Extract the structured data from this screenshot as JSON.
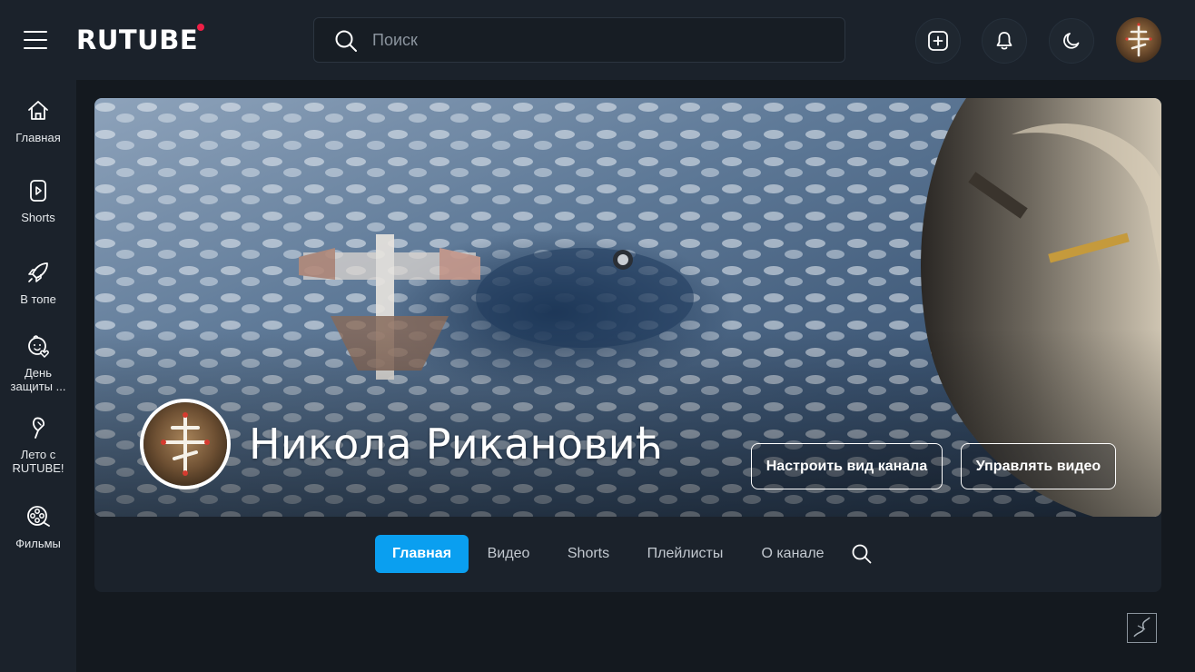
{
  "header": {
    "logo_text": "RUTUBE",
    "search_placeholder": "Поиск",
    "accent_dot_color": "#ee1f46"
  },
  "sidebar": {
    "items": [
      {
        "label": "Главная",
        "icon": "home-icon"
      },
      {
        "label": "Shorts",
        "icon": "shorts-icon"
      },
      {
        "label": "В топе",
        "icon": "rocket-icon"
      },
      {
        "label": "День\nзащиты ...",
        "icon": "child-heart-icon"
      },
      {
        "label": "Лето с\nRUTUBE!",
        "icon": "ice-cream-icon"
      },
      {
        "label": "Фильмы",
        "icon": "film-reel-icon"
      }
    ]
  },
  "channel": {
    "name": "Никола Рикановић",
    "customize_button": "Настроить вид канала",
    "manage_button": "Управлять видео"
  },
  "tabs": {
    "items": [
      {
        "label": "Главная",
        "active": true
      },
      {
        "label": "Видео",
        "active": false
      },
      {
        "label": "Shorts",
        "active": false
      },
      {
        "label": "Плейлисты",
        "active": false
      },
      {
        "label": "О канале",
        "active": false
      }
    ]
  },
  "colors": {
    "background": "#14191f",
    "panel": "#1b222b",
    "active_tab": "#0a9ff0"
  }
}
